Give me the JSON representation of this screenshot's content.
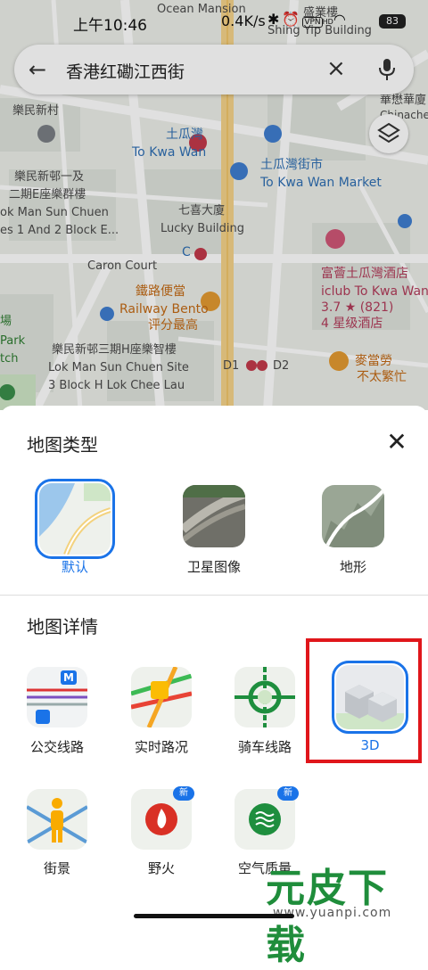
{
  "status_bar": {
    "time": "上午10:46",
    "speed": "0.4K/s",
    "battery": "83",
    "icons": [
      "bluetooth-icon",
      "alarm-icon",
      "vpn-icon",
      "hd-icon",
      "wifi-icon"
    ],
    "vpn": "VPN",
    "hd": "HD"
  },
  "search": {
    "query": "香港红磡江西街"
  },
  "map_labels": [
    {
      "text": "Ocean Mansion",
      "cls": ""
    },
    {
      "text": "盛業樓",
      "cls": ""
    },
    {
      "text": "Shing Yip Building",
      "cls": ""
    },
    {
      "text": "華懋華廈",
      "cls": ""
    },
    {
      "text": "Chinachem",
      "cls": "small"
    },
    {
      "text": "樂民新村",
      "cls": ""
    },
    {
      "text": "土瓜灣",
      "cls": "blue"
    },
    {
      "text": "To Kwa Wan",
      "cls": "blue"
    },
    {
      "text": "土瓜灣街市",
      "cls": "blue"
    },
    {
      "text": "To Kwa Wan Market",
      "cls": "blue"
    },
    {
      "text": "樂民新邨一及",
      "cls": ""
    },
    {
      "text": "二期E座樂群樓",
      "cls": ""
    },
    {
      "text": "ok Man Sun Chuen",
      "cls": ""
    },
    {
      "text": "es 1 And 2 Block E...",
      "cls": ""
    },
    {
      "text": "七喜大廈",
      "cls": ""
    },
    {
      "text": "Lucky Building",
      "cls": ""
    },
    {
      "text": "Caron Court",
      "cls": ""
    },
    {
      "text": "C",
      "cls": "blue"
    },
    {
      "text": "富薈土瓜灣酒店",
      "cls": "pink"
    },
    {
      "text": "iclub To Kwa Wan",
      "cls": "pink"
    },
    {
      "text": "3.7 ★ (821)",
      "cls": "pink"
    },
    {
      "text": "4 星级酒店",
      "cls": "pink"
    },
    {
      "text": "鐵路便當",
      "cls": "orange"
    },
    {
      "text": "Railway Bento",
      "cls": "orange"
    },
    {
      "text": "评分最高",
      "cls": "orange"
    },
    {
      "text": "場",
      "cls": "green"
    },
    {
      "text": "Park",
      "cls": "green"
    },
    {
      "text": "tch",
      "cls": "green"
    },
    {
      "text": "樂民新邨三期H座樂智樓",
      "cls": ""
    },
    {
      "text": "Lok Man Sun Chuen Site",
      "cls": ""
    },
    {
      "text": "3 Block H Lok Chee Lau",
      "cls": ""
    },
    {
      "text": "D1",
      "cls": ""
    },
    {
      "text": "D2",
      "cls": ""
    },
    {
      "text": "麥當勞",
      "cls": "orange"
    },
    {
      "text": "不太繁忙",
      "cls": "orange"
    }
  ],
  "sheet": {
    "map_type_title": "地图类型",
    "map_details_title": "地图详情",
    "map_types": [
      {
        "label": "默认",
        "selected": true
      },
      {
        "label": "卫星图像",
        "selected": false
      },
      {
        "label": "地形",
        "selected": false
      }
    ],
    "details": [
      {
        "label": "公交线路",
        "selected": false,
        "badge": ""
      },
      {
        "label": "实时路况",
        "selected": false,
        "badge": ""
      },
      {
        "label": "骑车线路",
        "selected": false,
        "badge": ""
      },
      {
        "label": "3D",
        "selected": true,
        "badge": ""
      },
      {
        "label": "街景",
        "selected": false,
        "badge": ""
      },
      {
        "label": "野火",
        "selected": false,
        "badge": "新"
      },
      {
        "label": "空气质量",
        "selected": false,
        "badge": "新"
      }
    ],
    "transit_badge": "M"
  },
  "watermark": {
    "title": "元皮下载",
    "url": "www.yuanpi.com"
  },
  "colors": {
    "accent": "#1a73e8",
    "highlight": "#e0161b"
  }
}
